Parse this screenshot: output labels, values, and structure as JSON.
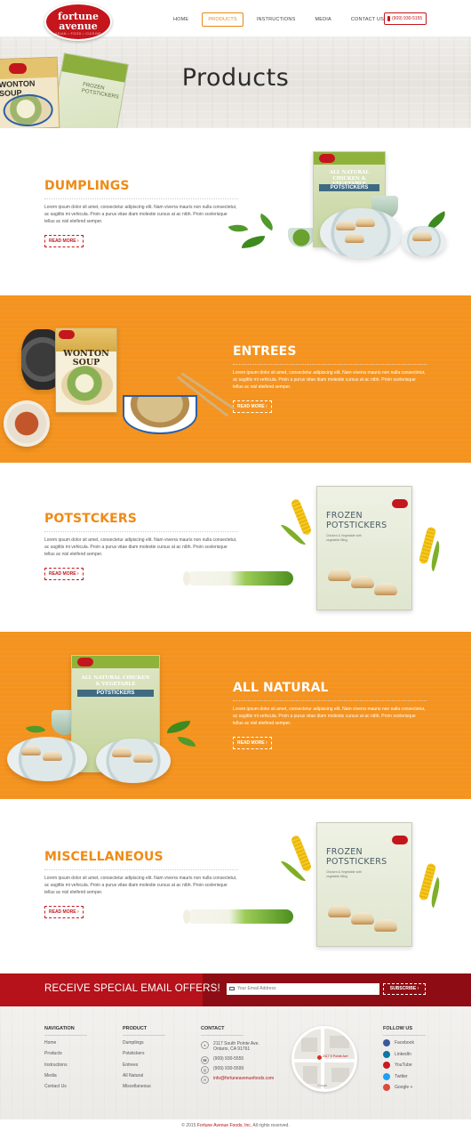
{
  "header": {
    "logo": {
      "line1": "fortune",
      "line2": "avenue",
      "tagline": "ASIAN • FOOD • CUISINE"
    },
    "nav": [
      {
        "label": "HOME"
      },
      {
        "label": "PRODUCTS",
        "active": true
      },
      {
        "label": "INSTRUCTIONS"
      },
      {
        "label": "MEDIA"
      },
      {
        "label": "CONTACT US"
      }
    ],
    "phone": "(909) 930-5155"
  },
  "hero": {
    "title": "Products",
    "pkg1_title": "WONTON SOUP",
    "pkg2_title": "FROZEN POTSTICKERS"
  },
  "sections": [
    {
      "title": "DUMPLINGS",
      "body": "Lorem ipsum dolor sit amet, consectetur adipiscing elit. Nam viverra mauris non nulla consectetur, ac sagittis mi vehicula. Proin a purus vitae diam molestie cursus at ac nibh. Proin scelerisque tellus ac nisl eleifend semper.",
      "read_more": "READ MORE ›",
      "package_caption": "ALL NATURAL CHICKEN & VEGETABLE",
      "package_name": "POTSTICKERS"
    },
    {
      "title": "ENTREES",
      "body": "Lorem ipsum dolor sit amet, consectetur adipiscing elit. Nam viverra mauris non nulla consectetur, ac sagittis mi vehicula. Proin a purus vitae diam molestie cursus at ac nibh. Proin scelerisque tellus ac nisl eleifend semper.",
      "read_more": "READ MORE ›",
      "package_name": "WONTON SOUP"
    },
    {
      "title": "POTSTCKERS",
      "body": "Lorem ipsum dolor sit amet, consectetur adipiscing elit. Nam viverra mauris non nulla consectetur, ac sagittis mi vehicula. Proin a purus vitae diam molestie cursus at ac nibh. Proin scelerisque tellus ac nisl eleifend semper.",
      "read_more": "READ MORE ›",
      "package_name_1": "FROZEN",
      "package_name_2": "POTSTICKERS",
      "package_sub": "Chicken & Vegetable with vegetable filling"
    },
    {
      "title": "ALL NATURAL",
      "body": "Lorem ipsum dolor sit amet, consectetur adipiscing elit. Nam viverra mauris non nulla consectetur, ac sagittis mi vehicula. Proin a purus vitae diam molestie cursus at ac nibh. Proin scelerisque tellus ac nisl eleifend semper.",
      "read_more": "READ MORE ›",
      "package_caption": "ALL NATURAL CHICKEN & VEGETABLE",
      "package_name": "POTSTICKERS"
    },
    {
      "title": "MISCELLANEOUS",
      "body": "Lorem ipsum dolor sit amet, consectetur adipiscing elit. Nam viverra mauris non nulla consectetur, ac sagittis mi vehicula. Proin a purus vitae diam molestie cursus at ac nibh. Proin scelerisque tellus ac nisl eleifend semper.",
      "read_more": "READ MORE ›",
      "package_name_1": "FROZEN",
      "package_name_2": "POTSTICKERS",
      "package_sub": "Chicken & Vegetable with vegetable filling"
    }
  ],
  "subscribe": {
    "title": "RECEIVE SPECIAL EMAIL OFFERS!",
    "placeholder": "Your Email Address",
    "button": "SUBSCRIBE ›"
  },
  "footer": {
    "navigation": {
      "heading": "NAVIGATION",
      "links": [
        "Home",
        "Products",
        "Instructions",
        "Media",
        "Contact Us"
      ]
    },
    "product": {
      "heading": "PRODUCT",
      "links": [
        "Dumplings",
        "Potstickers",
        "Entrees",
        "All Natural",
        "Miscellaneous"
      ]
    },
    "contact": {
      "heading": "CONTACT",
      "address_1": "2117 South Pointe Ave.",
      "address_2": "Ontario, CA 91761",
      "phone": "(909) 930-5555",
      "fax": "(909) 930-5599",
      "email": "info@fortuneavenuefoods.com"
    },
    "map": {
      "label": "2117 S Pointe Ave",
      "attribution": "Google"
    },
    "follow": {
      "heading": "FOLLOW US",
      "items": [
        {
          "label": "Facebook",
          "color": "#3b5998"
        },
        {
          "label": "LinkedIn",
          "color": "#0e76a8"
        },
        {
          "label": "YouTube",
          "color": "#cc181e"
        },
        {
          "label": "Twitter",
          "color": "#1da1f2"
        },
        {
          "label": "Google +",
          "color": "#dd4b39"
        }
      ]
    },
    "copyright_prefix": "© 2015",
    "copyright_brand": "Fortune Avenue Foods, Inc.",
    "copyright_suffix": "All rights reserved."
  },
  "colors": {
    "accent_orange": "#f4931f",
    "brand_red": "#c4161c",
    "title_orange": "#ee8b16"
  }
}
